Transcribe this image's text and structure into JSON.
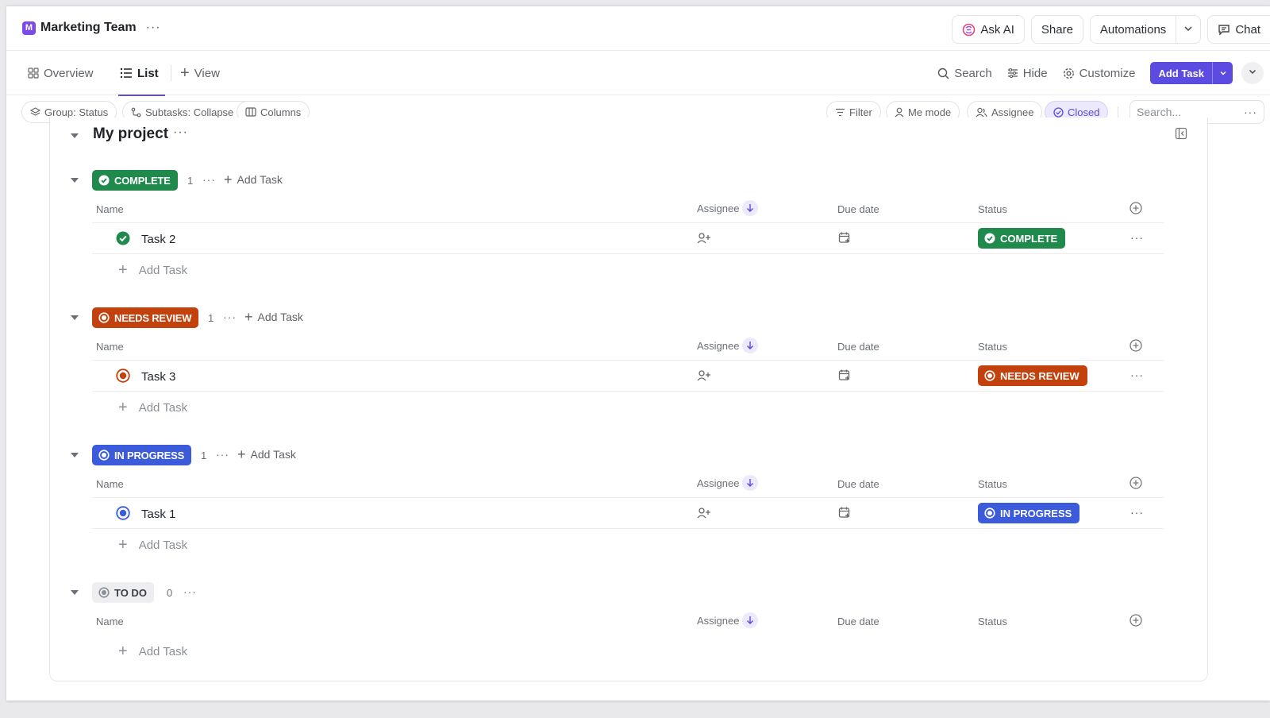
{
  "header": {
    "workspace_badge": "M",
    "workspace_name": "Marketing Team",
    "more": "···",
    "ask_ai": "Ask AI",
    "share": "Share",
    "automations": "Automations",
    "chat": "Chat"
  },
  "tabs": {
    "overview": "Overview",
    "list": "List",
    "view": "View"
  },
  "tools": {
    "search": "Search",
    "hide": "Hide",
    "customize": "Customize",
    "add_task": "Add Task"
  },
  "filters": {
    "group": "Group: Status",
    "subtasks": "Subtasks: Collapse all",
    "columns": "Columns",
    "filter": "Filter",
    "me_mode": "Me mode",
    "assignee": "Assignee",
    "closed": "Closed",
    "search_placeholder": "Search...",
    "more": "···"
  },
  "project": {
    "title": "My project",
    "more": "···"
  },
  "columns": {
    "name": "Name",
    "assignee": "Assignee",
    "due_date": "Due date",
    "status": "Status"
  },
  "add_task_label": "Add Task",
  "groups": [
    {
      "status": "COMPLETE",
      "count": "1",
      "color": "#1f8a4c",
      "tasks": [
        {
          "name": "Task 2",
          "status": "COMPLETE"
        }
      ]
    },
    {
      "status": "NEEDS REVIEW",
      "count": "1",
      "color": "#c2410c",
      "tasks": [
        {
          "name": "Task 3",
          "status": "NEEDS REVIEW"
        }
      ]
    },
    {
      "status": "IN PROGRESS",
      "count": "1",
      "color": "#3b5bdb",
      "tasks": [
        {
          "name": "Task 1",
          "status": "IN PROGRESS"
        }
      ]
    },
    {
      "status": "TO DO",
      "count": "0",
      "color": "#8a8f98",
      "tasks": []
    }
  ],
  "colors": {
    "accent": "#5b4be0",
    "complete": "#1f8a4c",
    "needs_review": "#c2410c",
    "in_progress": "#3b5bdb",
    "todo": "#8a8f98"
  }
}
